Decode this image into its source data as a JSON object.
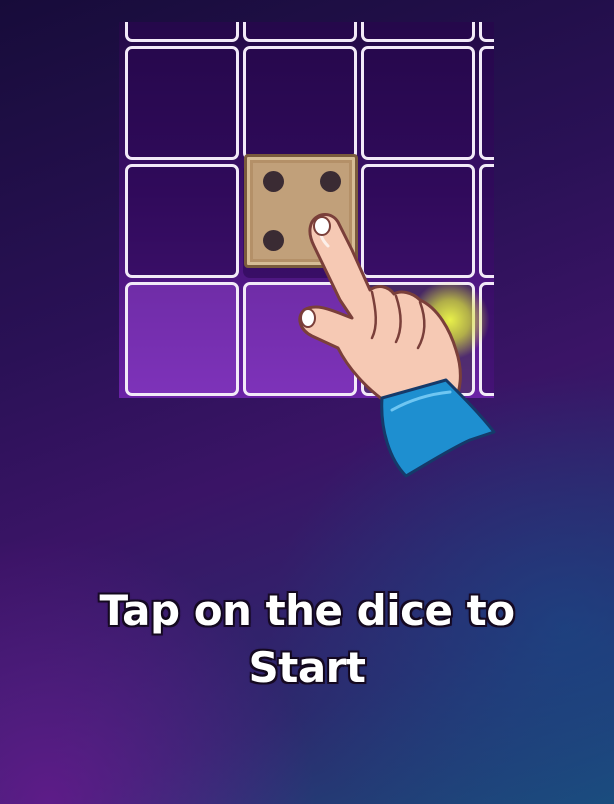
{
  "tutorial": {
    "instruction_line1": "Tap on the dice to",
    "instruction_line2": "Start"
  },
  "board": {
    "dice_value": 4,
    "dice_color": "#c1a07a",
    "pip_color": "#3a2b33",
    "grid_line_color": "#f2eaf8"
  },
  "hand_icon": "pointing-hand-icon",
  "accent": {
    "tap_glow": "#e8f04a",
    "sleeve": "#1e8fd0"
  }
}
